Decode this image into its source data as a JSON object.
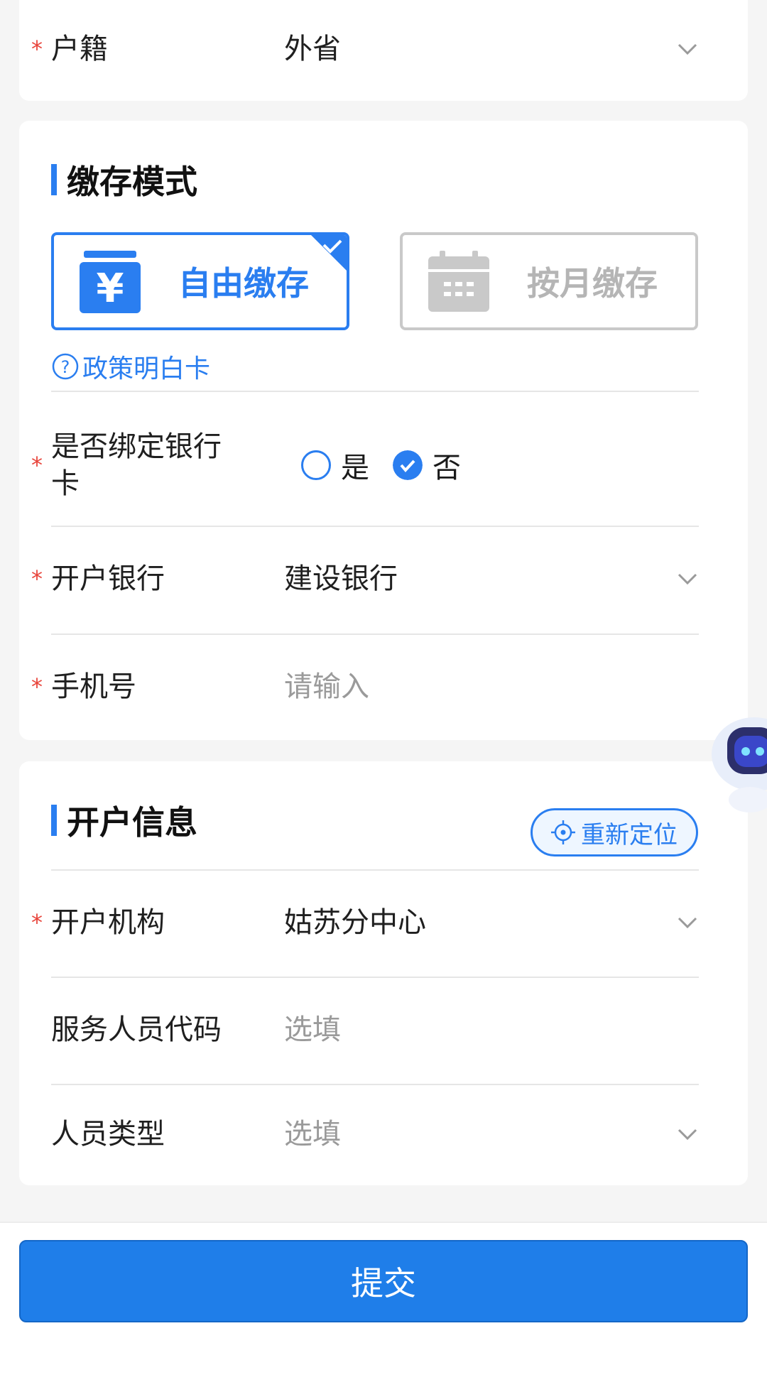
{
  "card_top": {
    "household": {
      "label": "户籍",
      "value": "外省"
    }
  },
  "deposit_section": {
    "title": "缴存模式",
    "modes": [
      {
        "label": "自由缴存",
        "selected": true,
        "icon": "yuan-wallet-icon"
      },
      {
        "label": "按月缴存",
        "selected": false,
        "icon": "calendar-icon"
      }
    ],
    "policy_link": "政策明白卡",
    "bind_card": {
      "label": "是否绑定银行卡",
      "options": [
        "是",
        "否"
      ],
      "selected": "否"
    },
    "bank": {
      "label": "开户银行",
      "value": "建设银行"
    },
    "phone": {
      "label": "手机号",
      "placeholder": "请输入"
    }
  },
  "account_section": {
    "title": "开户信息",
    "relocate_label": "重新定位",
    "institution": {
      "label": "开户机构",
      "value": "姑苏分中心"
    },
    "service_code": {
      "label": "服务人员代码",
      "placeholder": "选填"
    },
    "person_type": {
      "label": "人员类型",
      "placeholder": "选填"
    }
  },
  "footer": {
    "submit_label": "提交"
  },
  "colors": {
    "accent": "#2a7ef0",
    "required": "#e8453c",
    "submit": "#1f7ee9"
  }
}
